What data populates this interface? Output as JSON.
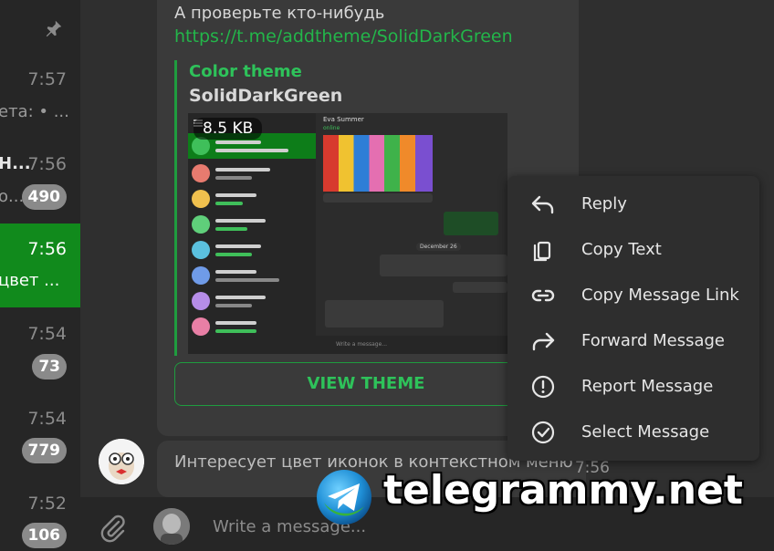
{
  "chat_list": [
    {
      "time": "",
      "preview": "",
      "badge": "",
      "pinned": true
    },
    {
      "time": "7:57",
      "preview": "ета: • ...",
      "badge": ""
    },
    {
      "time": "7:56",
      "preview": "о...",
      "badge": "490",
      "sender": "Н..."
    },
    {
      "time": "7:56",
      "preview": "цвет ...",
      "badge": "",
      "active": true
    },
    {
      "time": "7:54",
      "preview": "",
      "badge": "73"
    },
    {
      "time": "7:54",
      "preview": "",
      "badge": "779"
    },
    {
      "time": "7:52",
      "preview": "",
      "badge": "106"
    }
  ],
  "message": {
    "text": "А проверьте кто-нибудь",
    "link": "https://t.me/addtheme/SolidDarkGreen",
    "preview": {
      "site": "Color theme",
      "title": "SolidDarkGreen",
      "size": "8.5 KB",
      "button": "VIEW THEME"
    }
  },
  "mini": {
    "contact": "Eva Summer",
    "status": "online",
    "date": "December 26",
    "input_placeholder": "Write a message..."
  },
  "context_menu": [
    {
      "label": "Reply",
      "icon": "reply-icon"
    },
    {
      "label": "Copy Text",
      "icon": "copy-icon"
    },
    {
      "label": "Copy Message Link",
      "icon": "link-icon"
    },
    {
      "label": "Forward Message",
      "icon": "forward-icon"
    },
    {
      "label": "Report Message",
      "icon": "report-icon"
    },
    {
      "label": "Select Message",
      "icon": "select-icon"
    }
  ],
  "message2": {
    "text": "Интересует цвет иконок в контекстном меню",
    "time": "7:56"
  },
  "composer": {
    "placeholder": "Write a message..."
  },
  "watermark": {
    "text": "telegrammy.net"
  },
  "colors": {
    "accent": "#118a1c",
    "link": "#23b64a",
    "background": "#2f2f2f",
    "menu": "#2e2e2e"
  }
}
